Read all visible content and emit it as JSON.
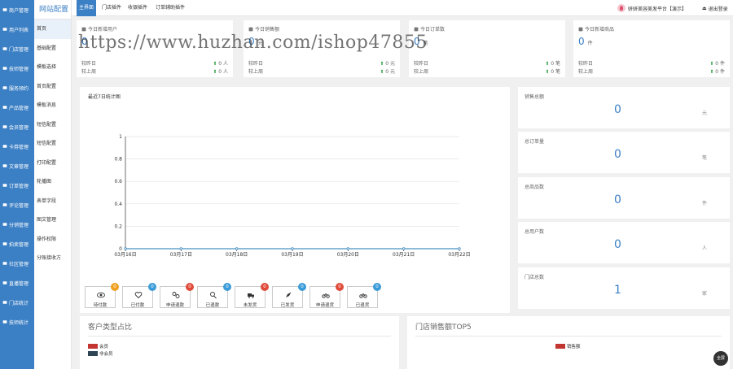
{
  "leftnav": [
    "商户管理",
    "用户列表",
    "门店管理",
    "技师管理",
    "服务预约",
    "产品管理",
    "会员管理",
    "卡券管理",
    "文章管理",
    "订单管理",
    "评论管理",
    "分销管理",
    "拍卖管理",
    "社区管理",
    "直播管理",
    "门店统计",
    "技师统计"
  ],
  "subnav": {
    "title": "网站配置",
    "items": [
      "首页",
      "基础配置",
      "模板选择",
      "首页配置",
      "模板消息",
      "短信配置",
      "短信配置",
      "打印配置",
      "轮播图",
      "表单字段",
      "图文管理",
      "操作权限",
      "分账接收方"
    ]
  },
  "topbar": {
    "tabs": [
      "主界面",
      "门店插件",
      "收银插件",
      "订单辅助插件"
    ],
    "user": "妍妍美容美发平台【演示】",
    "logout": "退出登录"
  },
  "stats": [
    {
      "title": "今日新增用户",
      "value": "0",
      "unit": "",
      "r1l": "较昨日",
      "r1v": "0 人",
      "r2l": "较上周",
      "r2v": "0 人"
    },
    {
      "title": "今日销售额",
      "value": "0",
      "unit": "元",
      "r1l": "较昨日",
      "r1v": "0 元",
      "r2l": "较上周",
      "r2v": "0 元"
    },
    {
      "title": "今日订单数",
      "value": "0",
      "unit": "笔",
      "r1l": "较昨日",
      "r1v": "0 笔",
      "r2l": "较上周",
      "r2v": "0 笔"
    },
    {
      "title": "今日新增商品",
      "value": "0",
      "unit": "件",
      "r1l": "较昨日",
      "r1v": "0 件",
      "r2l": "较上周",
      "r2v": "0 件"
    }
  ],
  "chart_title": "最近7日统计图",
  "chart_data": {
    "type": "line",
    "categories": [
      "03月16日",
      "03月17日",
      "03月18日",
      "03月19日",
      "03月20日",
      "03月21日",
      "03月22日"
    ],
    "series": [
      {
        "values": [
          0,
          0,
          0,
          0,
          0,
          0,
          0
        ]
      }
    ],
    "yticks": [
      "0",
      "0.2",
      "0.4",
      "0.6",
      "0.8",
      "1"
    ],
    "ylim": [
      0,
      1
    ],
    "grid": true,
    "color": "#4a90c4"
  },
  "rcards": [
    {
      "label": "销售总额",
      "value": "0",
      "unit": "元"
    },
    {
      "label": "总订单量",
      "value": "0",
      "unit": "笔"
    },
    {
      "label": "总商品数",
      "value": "0",
      "unit": "件"
    },
    {
      "label": "总用户数",
      "value": "0",
      "unit": "人"
    },
    {
      "label": "门店总数",
      "value": "1",
      "unit": "家"
    }
  ],
  "orders": [
    {
      "label": "待付款",
      "count": "0",
      "color": "#f0a020",
      "icon": "eye"
    },
    {
      "label": "已付款",
      "count": "0",
      "color": "#3b9bd8",
      "icon": "heart"
    },
    {
      "label": "申请退款",
      "count": "0",
      "color": "#e04a3a",
      "icon": "link"
    },
    {
      "label": "已退款",
      "count": "0",
      "color": "#3b9bd8",
      "icon": "refund"
    },
    {
      "label": "未发货",
      "count": "0",
      "color": "#e04a3a",
      "icon": "truck"
    },
    {
      "label": "已发货",
      "count": "0",
      "color": "#3b9bd8",
      "icon": "rocket"
    },
    {
      "label": "申请退货",
      "count": "0",
      "color": "#e04a3a",
      "icon": "bike"
    },
    {
      "label": "已退货",
      "count": "0",
      "color": "#3b9bd8",
      "icon": "bike"
    }
  ],
  "pie1": {
    "title": "客户类型占比",
    "legend": [
      "会员",
      "非会员"
    ]
  },
  "pie2": {
    "title": "门店销售额TOP5",
    "legend": [
      "销售额"
    ]
  },
  "watermark": "https://www.huzhan.com/ishop47855",
  "fullscreen": "全屏",
  "colors": {
    "brand": "#3b7fc4",
    "up": "#2e9e44",
    "legend": "#c23531"
  }
}
